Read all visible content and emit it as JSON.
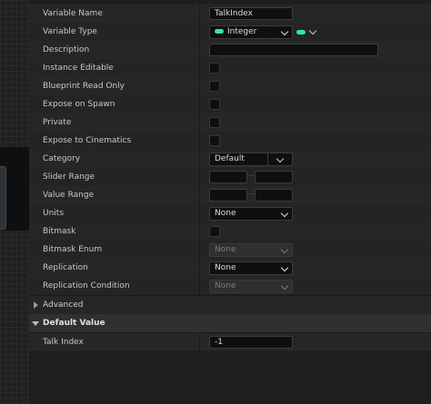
{
  "colors": {
    "integer_pin": "#2ee3b5"
  },
  "properties": {
    "variable_name": {
      "label": "Variable Name",
      "value": "TalkIndex"
    },
    "variable_type": {
      "label": "Variable Type",
      "value": "Integer",
      "pin_icon": "pill-icon",
      "container_icon": "pill-icon"
    },
    "description": {
      "label": "Description",
      "value": ""
    },
    "instance_editable": {
      "label": "Instance Editable",
      "checked": false
    },
    "blueprint_read_only": {
      "label": "Blueprint Read Only",
      "checked": false
    },
    "expose_on_spawn": {
      "label": "Expose on Spawn",
      "checked": false
    },
    "private": {
      "label": "Private",
      "checked": false
    },
    "expose_to_cinematics": {
      "label": "Expose to Cinematics",
      "checked": false
    },
    "category": {
      "label": "Category",
      "value": "Default"
    },
    "slider_range": {
      "label": "Slider Range",
      "min": "",
      "max": "",
      "separator": "..."
    },
    "value_range": {
      "label": "Value Range",
      "min": "",
      "max": "",
      "separator": "..."
    },
    "units": {
      "label": "Units",
      "value": "None"
    },
    "bitmask": {
      "label": "Bitmask",
      "checked": false
    },
    "bitmask_enum": {
      "label": "Bitmask Enum",
      "value": "None",
      "enabled": false
    },
    "replication": {
      "label": "Replication",
      "value": "None"
    },
    "replication_condition": {
      "label": "Replication Condition",
      "value": "None",
      "enabled": false
    }
  },
  "sections": {
    "advanced": {
      "label": "Advanced",
      "expanded": false
    },
    "default_value": {
      "label": "Default Value",
      "expanded": true
    }
  },
  "default_value": {
    "talk_index": {
      "label": "Talk Index",
      "value": "-1"
    }
  }
}
